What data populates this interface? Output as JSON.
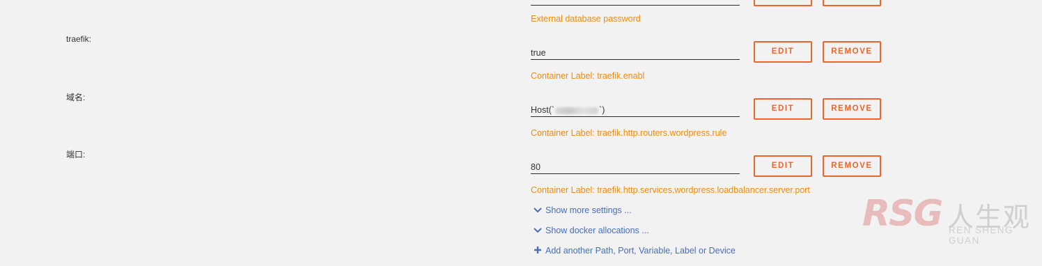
{
  "rows": [
    {
      "label": "",
      "value": "",
      "desc": "External database password"
    },
    {
      "label": "traefik:",
      "value": "true",
      "desc": "Container Label: traefik.enabl"
    },
    {
      "label": "域名:",
      "value_prefix": "Host(`",
      "value_suffix": "`)",
      "desc": "Container Label: traefik.http.routers.wordpress.rule"
    },
    {
      "label": "端口:",
      "value": "80",
      "desc": "Container Label: traefik.http.services.wordpress.loadbalancer.server.port"
    }
  ],
  "buttons": {
    "edit": "EDIT",
    "remove": "REMOVE"
  },
  "links": {
    "more_settings": "Show more settings ...",
    "docker_allocations": "Show docker allocations ...",
    "add_another": "Add another Path, Port, Variable, Label or Device"
  },
  "icons": {
    "chevron": "chevron-down-icon",
    "plus": "plus-icon"
  },
  "watermark": {
    "logo": "RSG",
    "cn": "人生观",
    "en": "REN SHENG GUAN"
  },
  "colors": {
    "accent": "#f0642a",
    "desc": "#ef8c0e",
    "link": "#486dba"
  }
}
